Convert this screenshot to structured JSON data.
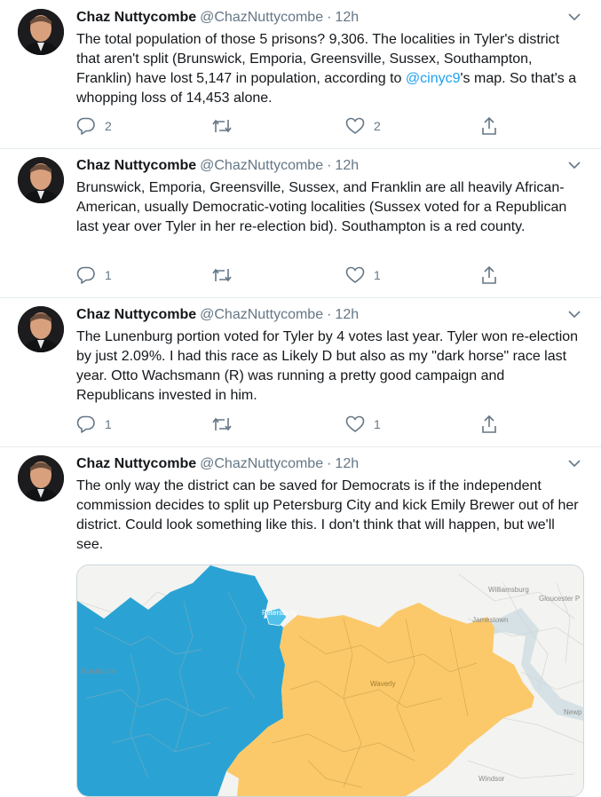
{
  "tweets": [
    {
      "name": "Chaz Nuttycombe",
      "handle": "@ChazNuttycombe",
      "time": "12h",
      "text_parts": [
        "The total population of those 5 prisons? 9,306. The localities in Tyler's district that aren't split (Brunswick, Emporia, Greensville, Sussex, Southampton, Franklin) have lost 5,147 in population, according to ",
        "@cinyc9",
        "'s map. So that's a whopping loss of 14,453 alone."
      ],
      "replies": "2",
      "retweets": "",
      "likes": "2"
    },
    {
      "name": "Chaz Nuttycombe",
      "handle": "@ChazNuttycombe",
      "time": "12h",
      "text": "Brunswick, Emporia, Greensville, Sussex, and Franklin are all heavily African-American, usually Democratic-voting localities (Sussex voted for a Republican last year over Tyler in her re-election bid). Southampton is a red county.",
      "replies": "1",
      "retweets": "",
      "likes": "1"
    },
    {
      "name": "Chaz Nuttycombe",
      "handle": "@ChazNuttycombe",
      "time": "12h",
      "text": "The Lunenburg portion voted for Tyler by 4 votes last year.  Tyler won re-election by just 2.09%. I had this race as Likely D but also as my \"dark horse\" race last year. Otto Wachsmann (R) was running a pretty good campaign and Republicans invested in him.",
      "replies": "1",
      "retweets": "",
      "likes": "1"
    },
    {
      "name": "Chaz Nuttycombe",
      "handle": "@ChazNuttycombe",
      "time": "12h",
      "text": "The only way the district can be saved for Democrats is if the independent commission decides to split up Petersburg City and kick Emily Brewer out of her district. Could look something like this. I don't think that will happen, but we'll see.",
      "map_labels": {
        "williamsburg": "Williamsburg",
        "gloucester": "Gloucester P",
        "jamestown": "Jamestown",
        "blackstone": "Blackstone",
        "petersburg": "Petersburg",
        "waverly": "Waverly",
        "newport": "Newp",
        "windsor": "Windsor"
      }
    }
  ],
  "separator": "·",
  "icons": [
    "avatar",
    "caret-down-icon",
    "reply-icon",
    "retweet-icon",
    "like-icon",
    "share-icon"
  ],
  "colors": {
    "link": "#1da1f2",
    "muted": "#657786",
    "district_blue": "#2aa3d4",
    "district_yellow": "#fbc96a"
  }
}
